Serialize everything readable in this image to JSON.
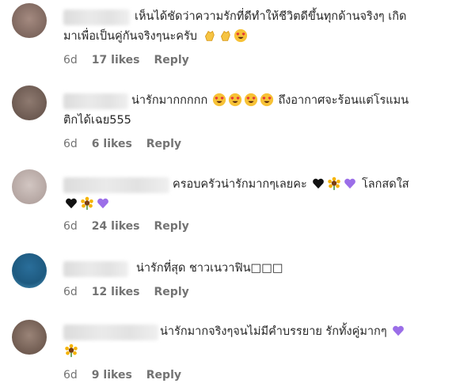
{
  "comments": [
    {
      "text_line1": "เห็นได้ชัดว่าความรักที่ดีทำให้ชีวิตดีขึ้นทุกด้านจริงๆ เกิด",
      "text_line2": "มาเพื่อเป็นคู่กันจริงๆนะครับ",
      "line2_emojis": [
        "clap-emoji",
        "clap-emoji",
        "heart-eyes-emoji"
      ],
      "age": "6d",
      "likes": "17 likes",
      "reply": "Reply",
      "avatar_color": "#8a7068"
    },
    {
      "text_line1_a": "น่ารักมากกกกก",
      "line1_emojis": [
        "heart-eyes-emoji",
        "heart-eyes-emoji",
        "heart-eyes-emoji",
        "heart-eyes-emoji"
      ],
      "text_line1_b": "ถึงอากาศจะร้อนแต่โรแมน",
      "text_line2": "ติกได้เฉย555",
      "age": "6d",
      "likes": "6 likes",
      "reply": "Reply",
      "avatar_color": "#7a6a62"
    },
    {
      "text_line1": "ครอบครัวน่ารักมากๆเลยคะ",
      "text_line1_b": "โลกสดใส",
      "line1_emojis": [
        "black-heart-emoji",
        "sunflower-emoji",
        "purple-heart-emoji"
      ],
      "line2_emojis": [
        "black-heart-emoji",
        "sunflower-emoji",
        "purple-heart-emoji"
      ],
      "age": "6d",
      "likes": "24 likes",
      "reply": "Reply",
      "avatar_color": "#b9aaa6"
    },
    {
      "text_line1": "น่ารักที่สุด ชาวเนวาฟิน□□□",
      "age": "6d",
      "likes": "12 likes",
      "reply": "Reply",
      "avatar_color": "#3d8ab0"
    },
    {
      "text_line1": "น่ารักมากจริงๆจนไม่มีคำบรรยาย รักทั้งคู่มากๆ",
      "line1_emojis": [
        "purple-heart-emoji"
      ],
      "line2_emojis": [
        "sunflower-emoji"
      ],
      "age": "6d",
      "likes": "9 likes",
      "reply": "Reply",
      "avatar_color": "#7d6a60"
    }
  ]
}
